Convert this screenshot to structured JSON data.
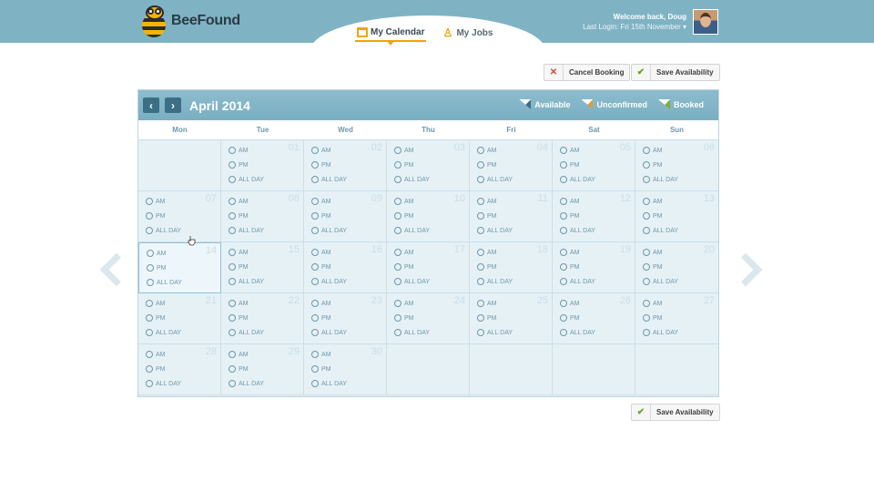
{
  "app": {
    "name": "BeeFound"
  },
  "nav": {
    "tabs": [
      {
        "label": "My Calendar",
        "active": true
      },
      {
        "label": "My Jobs",
        "active": false
      }
    ]
  },
  "user": {
    "welcome": "Welcome back, Doug",
    "last_login": "Last Login: Fri 15th November ▾"
  },
  "actions": {
    "cancel": "Cancel Booking",
    "save": "Save Availability",
    "save_bottom": "Save Availability"
  },
  "calendar": {
    "month": "April 2014",
    "legend": {
      "available": "Available",
      "unconfirmed": "Unconfirmed",
      "booked": "Booked"
    },
    "days_of_week": [
      "Mon",
      "Tue",
      "Wed",
      "Thu",
      "Fri",
      "Sat",
      "Sun"
    ],
    "slot_labels": {
      "am": "AM",
      "pm": "PM",
      "all": "ALL DAY"
    },
    "cells": [
      "",
      "01",
      "02",
      "03",
      "04",
      "05",
      "06",
      "07",
      "08",
      "09",
      "10",
      "11",
      "12",
      "13",
      "14",
      "15",
      "16",
      "17",
      "18",
      "19",
      "20",
      "21",
      "22",
      "23",
      "24",
      "25",
      "26",
      "27",
      "28",
      "29",
      "30",
      "",
      "",
      "",
      ""
    ],
    "highlighted": "14"
  },
  "icons": {
    "prev": "chevron-left-icon",
    "next": "chevron-right-icon"
  },
  "colors": {
    "header": "#7fb3c4",
    "accent": "#f0a500",
    "calendar_bg": "#e6f1f6"
  }
}
